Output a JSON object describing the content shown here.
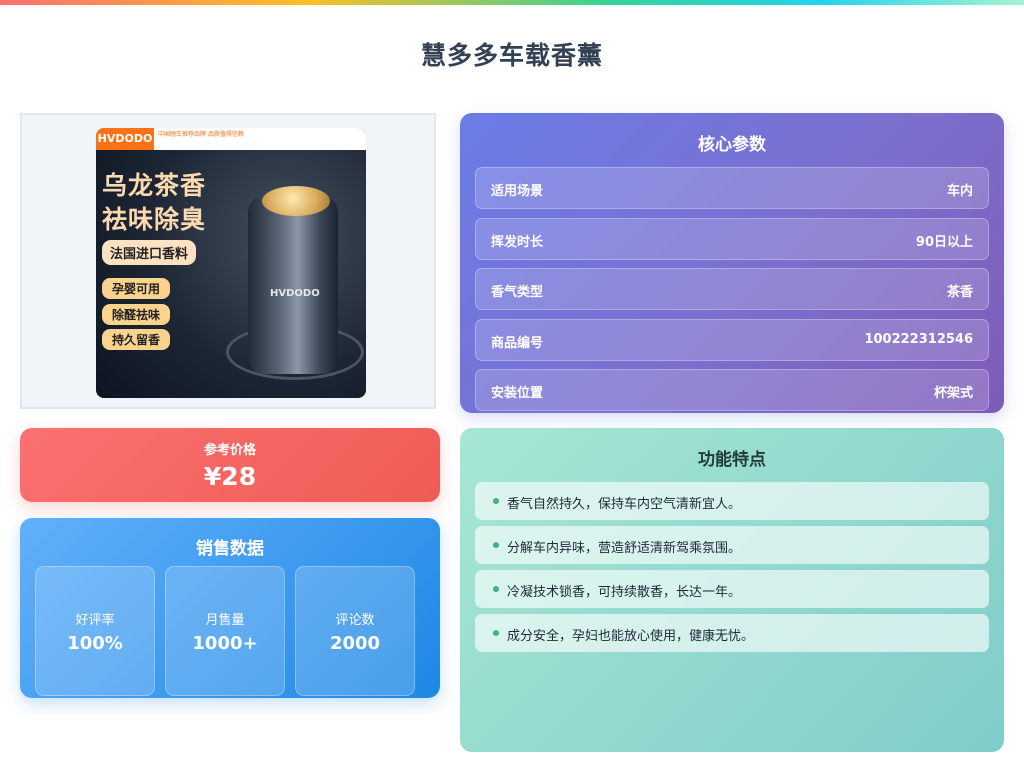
{
  "page": {
    "title": "慧多多车载香薰"
  },
  "product_image": {
    "brand": "HVDODO",
    "brand_note": "中国驰车推荐品牌 品质值得信赖",
    "slogan_lines": [
      "乌龙茶香",
      "祛味除臭"
    ],
    "feature_pill": "法国进口香料",
    "tags": [
      "孕婴可用",
      "除醛祛味",
      "持久留香"
    ]
  },
  "params": {
    "title": "核心参数",
    "rows": [
      {
        "label": "适用场景",
        "value": "车内"
      },
      {
        "label": "挥发时长",
        "value": "90日以上"
      },
      {
        "label": "香气类型",
        "value": "茶香"
      },
      {
        "label": "商品编号",
        "value": "100222312546"
      },
      {
        "label": "安装位置",
        "value": "杯架式"
      }
    ]
  },
  "price": {
    "label": "参考价格",
    "value": "¥28"
  },
  "sales": {
    "title": "销售数据",
    "stats": [
      {
        "label": "好评率",
        "value": "100%"
      },
      {
        "label": "月售量",
        "value": "1000+"
      },
      {
        "label": "评论数",
        "value": "2000"
      }
    ]
  },
  "features": {
    "title": "功能特点",
    "items": [
      "香气自然持久，保持车内空气清新宜人。",
      "分解车内异味，营造舒适清新驾乘氛围。",
      "冷凝技术锁香，可持续散香，长达一年。",
      "成分安全，孕妇也能放心使用，健康无忧。"
    ]
  }
}
